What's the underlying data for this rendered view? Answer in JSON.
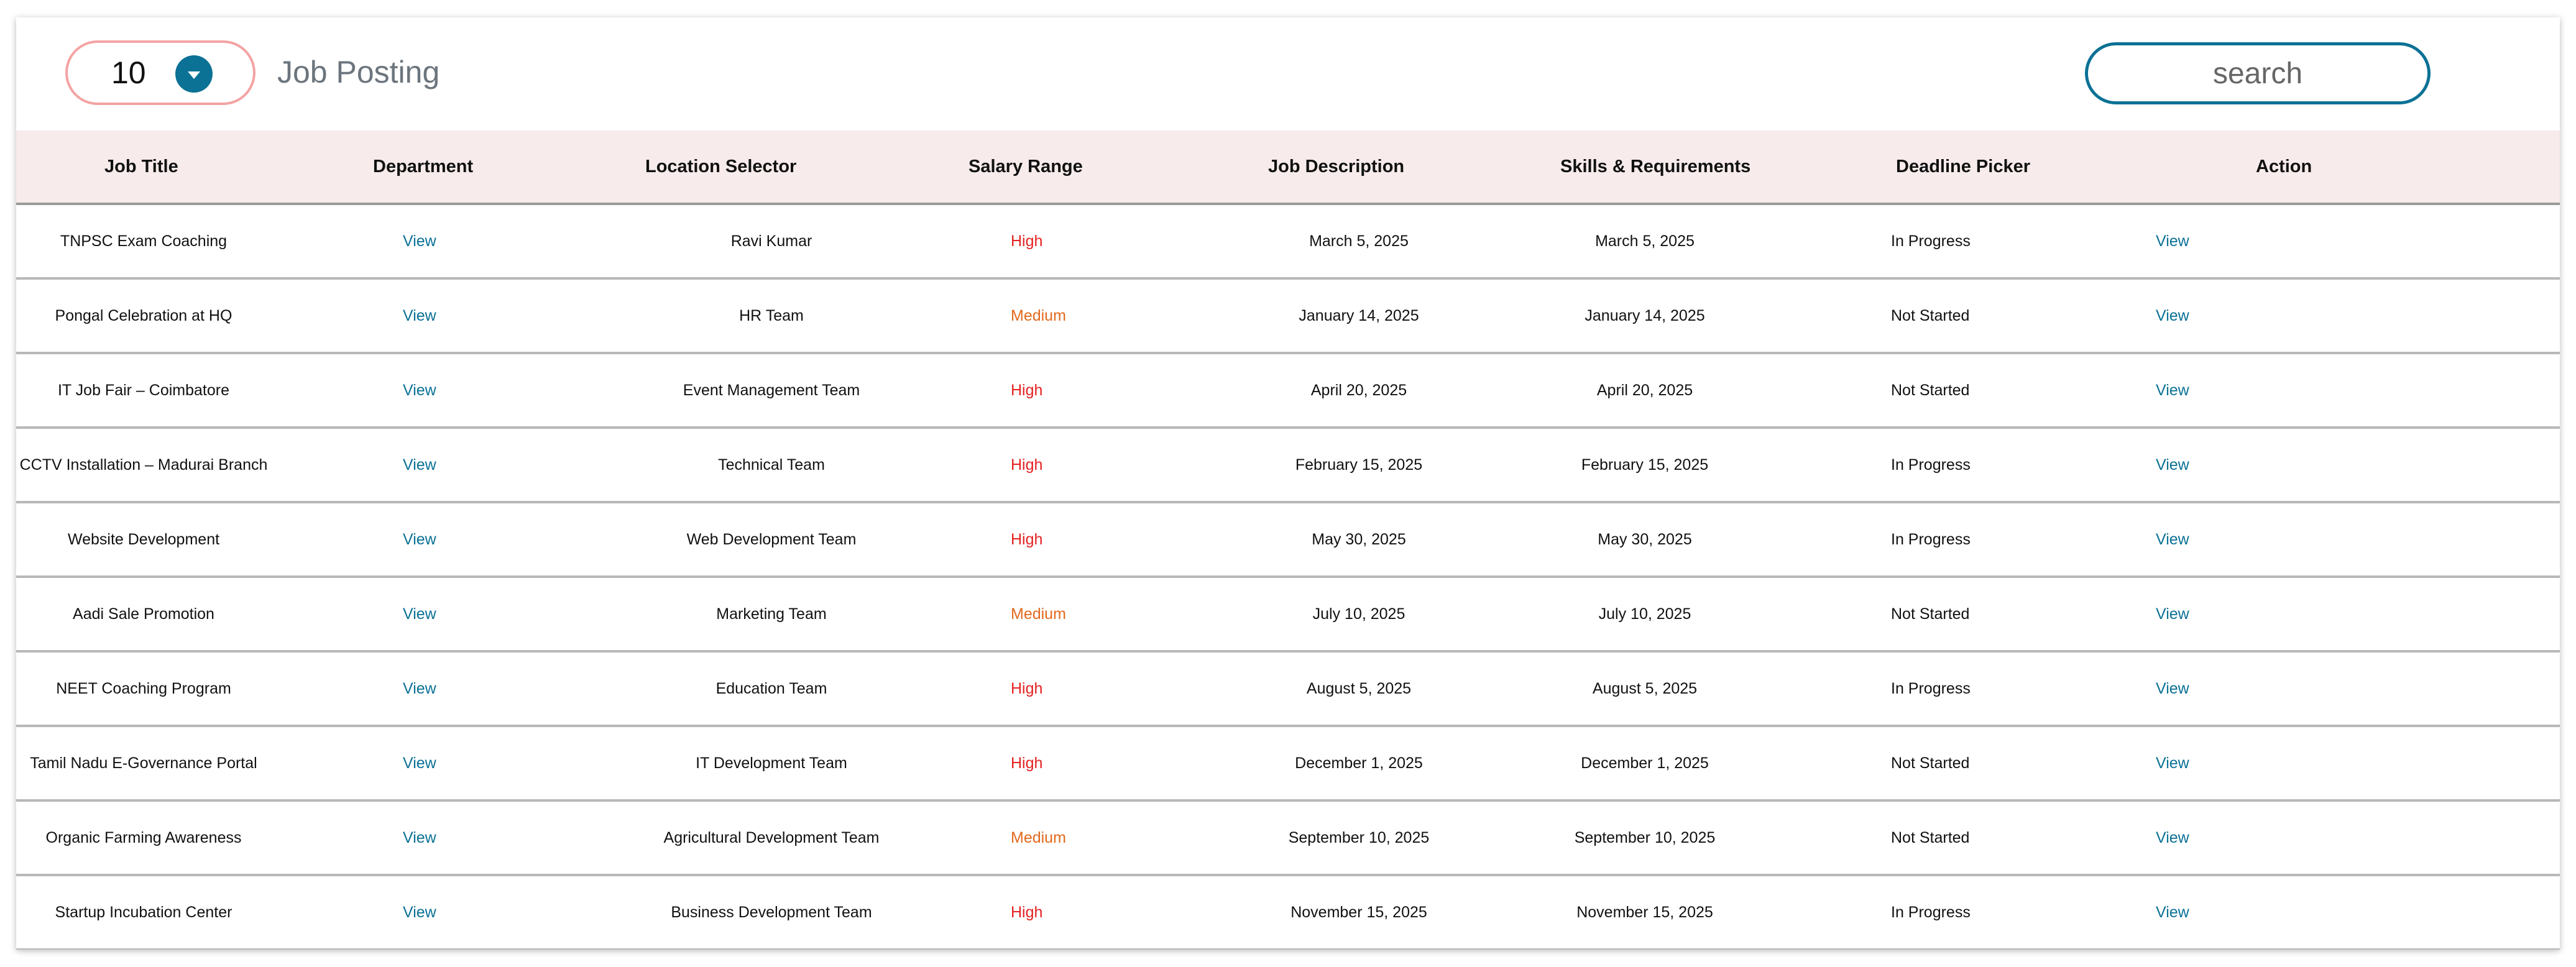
{
  "header": {
    "page_size": "10",
    "title": "Job Posting",
    "search_placeholder": "search"
  },
  "colors": {
    "accent": "#0b7195",
    "high": "#e52222",
    "medium": "#e2691d",
    "header_bg": "#f7ebeb"
  },
  "table": {
    "columns": [
      "Job Title",
      "Department",
      "Location Selector",
      "Salary Range",
      "Job Description",
      "Skills & Requirements",
      "Deadline Picker",
      "Action"
    ],
    "rows": [
      {
        "title": "TNPSC Exam Coaching",
        "dept": "View",
        "location": "Ravi Kumar",
        "salary": "High",
        "desc": "March 5, 2025",
        "skills": "March 5, 2025",
        "status": "In Progress",
        "deadline": "View",
        "action_icon": "eye-icon"
      },
      {
        "title": "Pongal Celebration at HQ",
        "dept": "View",
        "location": "HR Team",
        "salary": "Medium",
        "desc": "January 14, 2025",
        "skills": "January 14, 2025",
        "status": "Not Started",
        "deadline": "View",
        "action_icon": "eye-icon"
      },
      {
        "title": "IT Job Fair – Coimbatore",
        "dept": "View",
        "location": "Event Management Team",
        "salary": "High",
        "desc": "April 20, 2025",
        "skills": "April 20, 2025",
        "status": "Not Started",
        "deadline": "View",
        "action_icon": "eye-icon"
      },
      {
        "title": "CCTV Installation – Madurai Branch",
        "dept": "View",
        "location": "Technical Team",
        "salary": "High",
        "desc": "February 15, 2025",
        "skills": "February 15, 2025",
        "status": "In Progress",
        "deadline": "View",
        "action_icon": "eye-icon"
      },
      {
        "title": "Website Development",
        "dept": "View",
        "location": "Web Development Team",
        "salary": "High",
        "desc": "May 30, 2025",
        "skills": "May 30, 2025",
        "status": "In Progress",
        "deadline": "View",
        "action_icon": "eye-icon"
      },
      {
        "title": "Aadi Sale Promotion",
        "dept": "View",
        "location": "Marketing Team",
        "salary": "Medium",
        "desc": "July 10, 2025",
        "skills": "July 10, 2025",
        "status": "Not Started",
        "deadline": "View",
        "action_icon": "eye-icon"
      },
      {
        "title": "NEET Coaching Program",
        "dept": "View",
        "location": "Education Team",
        "salary": "High",
        "desc": "August 5, 2025",
        "skills": "August 5, 2025",
        "status": "In Progress",
        "deadline": "View",
        "action_icon": "eye-icon"
      },
      {
        "title": "Tamil Nadu E-Governance Portal",
        "dept": "View",
        "location": "IT Development Team",
        "salary": "High",
        "desc": "December 1, 2025",
        "skills": "December 1, 2025",
        "status": "Not Started",
        "deadline": "View",
        "action_icon": "eye-icon"
      },
      {
        "title": "Organic Farming Awareness",
        "dept": "View",
        "location": "Agricultural Development Team",
        "salary": "Medium",
        "desc": "September 10, 2025",
        "skills": "September 10, 2025",
        "status": "Not Started",
        "deadline": "View",
        "action_icon": "eye-icon"
      },
      {
        "title": "Startup Incubation Center",
        "dept": "View",
        "location": "Business Development Team",
        "salary": "High",
        "desc": "November 15, 2025",
        "skills": "November 15, 2025",
        "status": "In Progress",
        "deadline": "View",
        "action_icon": "eye-icon"
      }
    ]
  }
}
